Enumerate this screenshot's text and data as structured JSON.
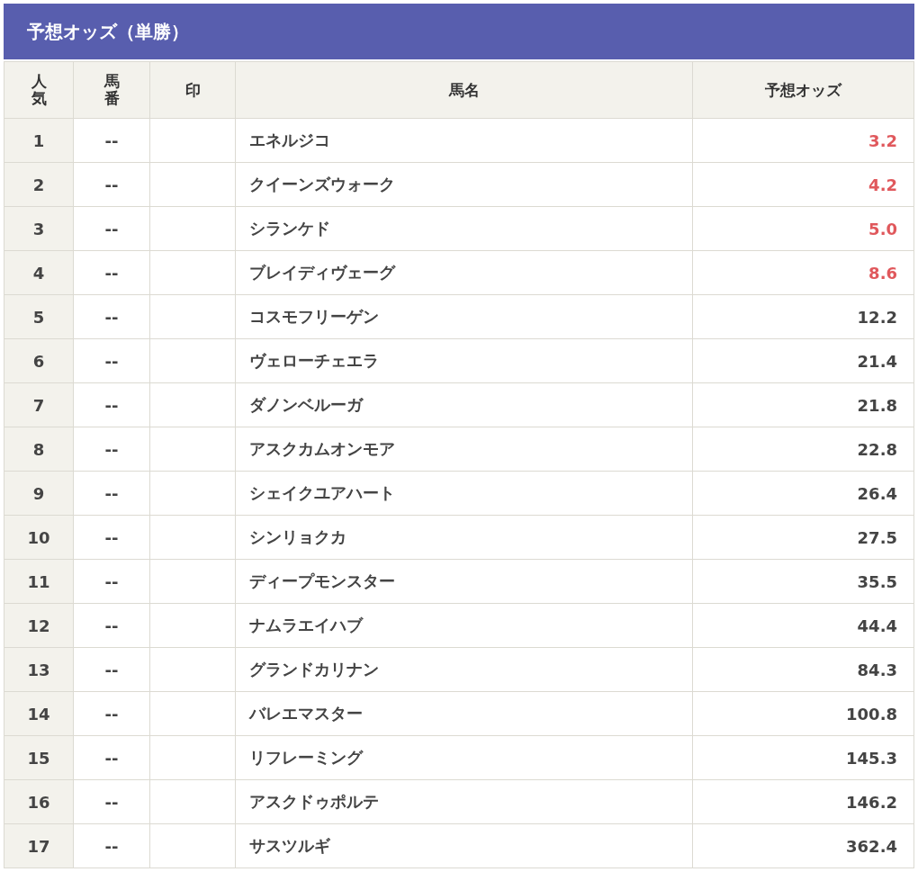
{
  "title": "予想オッズ（単勝）",
  "columns": [
    "人気",
    "馬番",
    "印",
    "馬名",
    "予想オッズ"
  ],
  "rows": [
    {
      "rank": "1",
      "number": "--",
      "mark": "",
      "name": "エネルジコ",
      "odds": "3.2",
      "highlight": true
    },
    {
      "rank": "2",
      "number": "--",
      "mark": "",
      "name": "クイーンズウォーク",
      "odds": "4.2",
      "highlight": true
    },
    {
      "rank": "3",
      "number": "--",
      "mark": "",
      "name": "シランケド",
      "odds": "5.0",
      "highlight": true
    },
    {
      "rank": "4",
      "number": "--",
      "mark": "",
      "name": "ブレイディヴェーグ",
      "odds": "8.6",
      "highlight": true
    },
    {
      "rank": "5",
      "number": "--",
      "mark": "",
      "name": "コスモフリーゲン",
      "odds": "12.2",
      "highlight": false
    },
    {
      "rank": "6",
      "number": "--",
      "mark": "",
      "name": "ヴェローチェエラ",
      "odds": "21.4",
      "highlight": false
    },
    {
      "rank": "7",
      "number": "--",
      "mark": "",
      "name": "ダノンベルーガ",
      "odds": "21.8",
      "highlight": false
    },
    {
      "rank": "8",
      "number": "--",
      "mark": "",
      "name": "アスクカムオンモア",
      "odds": "22.8",
      "highlight": false
    },
    {
      "rank": "9",
      "number": "--",
      "mark": "",
      "name": "シェイクユアハート",
      "odds": "26.4",
      "highlight": false
    },
    {
      "rank": "10",
      "number": "--",
      "mark": "",
      "name": "シンリョクカ",
      "odds": "27.5",
      "highlight": false
    },
    {
      "rank": "11",
      "number": "--",
      "mark": "",
      "name": "ディープモンスター",
      "odds": "35.5",
      "highlight": false
    },
    {
      "rank": "12",
      "number": "--",
      "mark": "",
      "name": "ナムラエイハブ",
      "odds": "44.4",
      "highlight": false
    },
    {
      "rank": "13",
      "number": "--",
      "mark": "",
      "name": "グランドカリナン",
      "odds": "84.3",
      "highlight": false
    },
    {
      "rank": "14",
      "number": "--",
      "mark": "",
      "name": "バレエマスター",
      "odds": "100.8",
      "highlight": false
    },
    {
      "rank": "15",
      "number": "--",
      "mark": "",
      "name": "リフレーミング",
      "odds": "145.3",
      "highlight": false
    },
    {
      "rank": "16",
      "number": "--",
      "mark": "",
      "name": "アスクドゥポルテ",
      "odds": "146.2",
      "highlight": false
    },
    {
      "rank": "17",
      "number": "--",
      "mark": "",
      "name": "サスツルギ",
      "odds": "362.4",
      "highlight": false
    }
  ]
}
